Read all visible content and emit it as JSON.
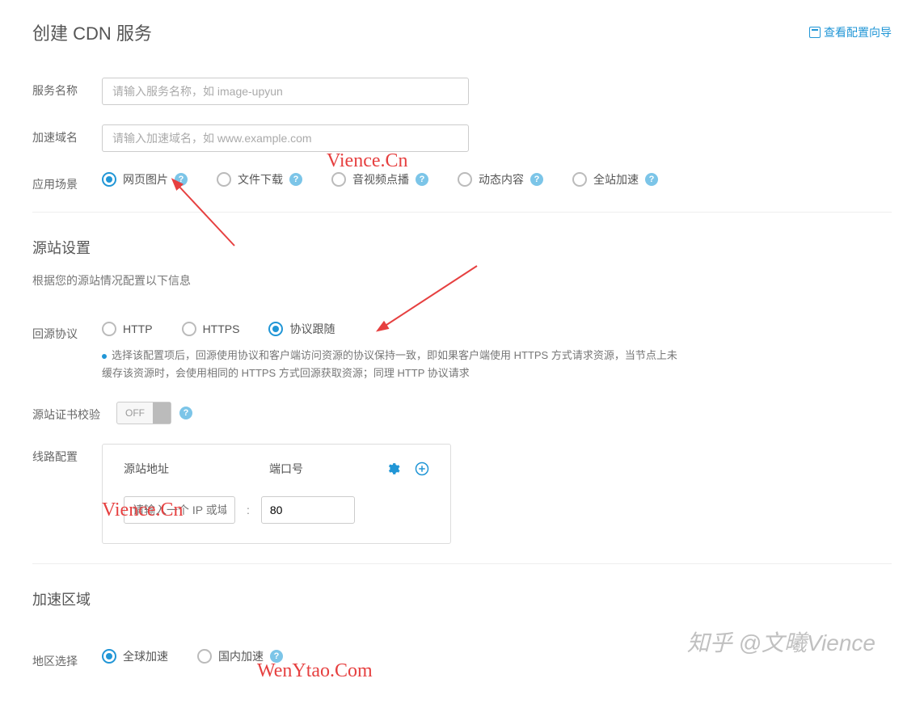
{
  "header": {
    "title": "创建 CDN 服务",
    "guide_label": "查看配置向导"
  },
  "form": {
    "service_name": {
      "label": "服务名称",
      "placeholder": "请输入服务名称，如 image-upyun",
      "value": ""
    },
    "domain": {
      "label": "加速域名",
      "placeholder": "请输入加速域名，如 www.example.com",
      "value": ""
    },
    "scenario": {
      "label": "应用场景",
      "options": [
        {
          "label": "网页图片",
          "selected": true
        },
        {
          "label": "文件下载",
          "selected": false
        },
        {
          "label": "音视频点播",
          "selected": false
        },
        {
          "label": "动态内容",
          "selected": false
        },
        {
          "label": "全站加速",
          "selected": false
        }
      ]
    }
  },
  "origin": {
    "section_title": "源站设置",
    "section_desc": "根据您的源站情况配置以下信息",
    "protocol": {
      "label": "回源协议",
      "options": [
        {
          "label": "HTTP",
          "selected": false
        },
        {
          "label": "HTTPS",
          "selected": false
        },
        {
          "label": "协议跟随",
          "selected": true
        }
      ],
      "hint": "选择该配置项后，回源使用协议和客户端访问资源的协议保持一致，即如果客户端使用 HTTPS 方式请求资源，当节点上未缓存该资源时，会使用相同的 HTTPS 方式回源获取资源；同理 HTTP 协议请求"
    },
    "cert_verify": {
      "label": "源站证书校验",
      "state": "OFF"
    },
    "route": {
      "label": "线路配置",
      "col_addr": "源站地址",
      "col_port": "端口号",
      "ip_placeholder": "请输入一个 IP 或域",
      "port_value": "80"
    }
  },
  "region": {
    "section_title": "加速区域",
    "label": "地区选择",
    "options": [
      {
        "label": "全球加速",
        "selected": true
      },
      {
        "label": "国内加速",
        "selected": false
      }
    ]
  },
  "watermarks": {
    "w1": "Vience.Cn",
    "w2": "Vience.Cn",
    "w3": "WenYtao.Com",
    "footer": "知乎 @文曦Vience"
  }
}
